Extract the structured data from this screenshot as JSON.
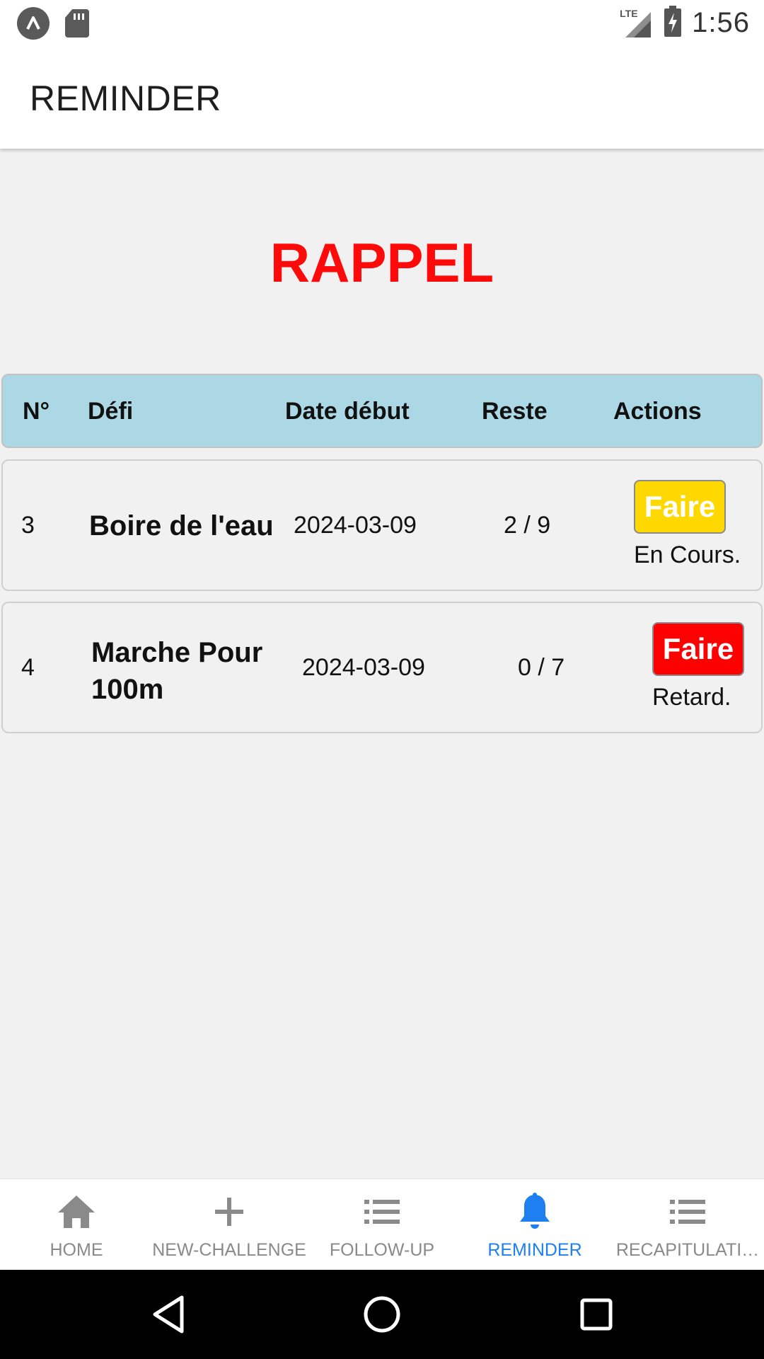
{
  "status_bar": {
    "time": "1:56",
    "network": "LTE"
  },
  "app_bar": {
    "title": "REMINDER"
  },
  "heading": "RAPPEL",
  "table": {
    "headers": {
      "number": "N°",
      "challenge": "Défi",
      "start_date": "Date début",
      "remaining": "Reste",
      "actions": "Actions"
    },
    "rows": [
      {
        "number": "3",
        "challenge": "Boire de l'eau",
        "start_date": "2024-03-09",
        "remaining": "2 / 9",
        "action_label": "Faire",
        "status": "En Cours.",
        "action_color": "#ffd800"
      },
      {
        "number": "4",
        "challenge": "Marche Pour 100m",
        "start_date": "2024-03-09",
        "remaining": "0 / 7",
        "action_label": "Faire",
        "status": "Retard.",
        "action_color": "#ff0000"
      }
    ]
  },
  "bottom_nav": {
    "items": [
      {
        "label": "HOME",
        "icon": "home-icon",
        "active": false
      },
      {
        "label": "NEW-CHALLENGE",
        "icon": "plus-icon",
        "active": false
      },
      {
        "label": "FOLLOW-UP",
        "icon": "list-icon",
        "active": false
      },
      {
        "label": "REMINDER",
        "icon": "bell-icon",
        "active": true
      },
      {
        "label": "RECAPITULATI…",
        "icon": "list-icon",
        "active": false
      }
    ],
    "active_color": "#1e7ff0",
    "inactive_color": "#8a8a8a"
  },
  "colors": {
    "heading": "#ff0a0a",
    "table_header_bg": "#acd8e5"
  }
}
